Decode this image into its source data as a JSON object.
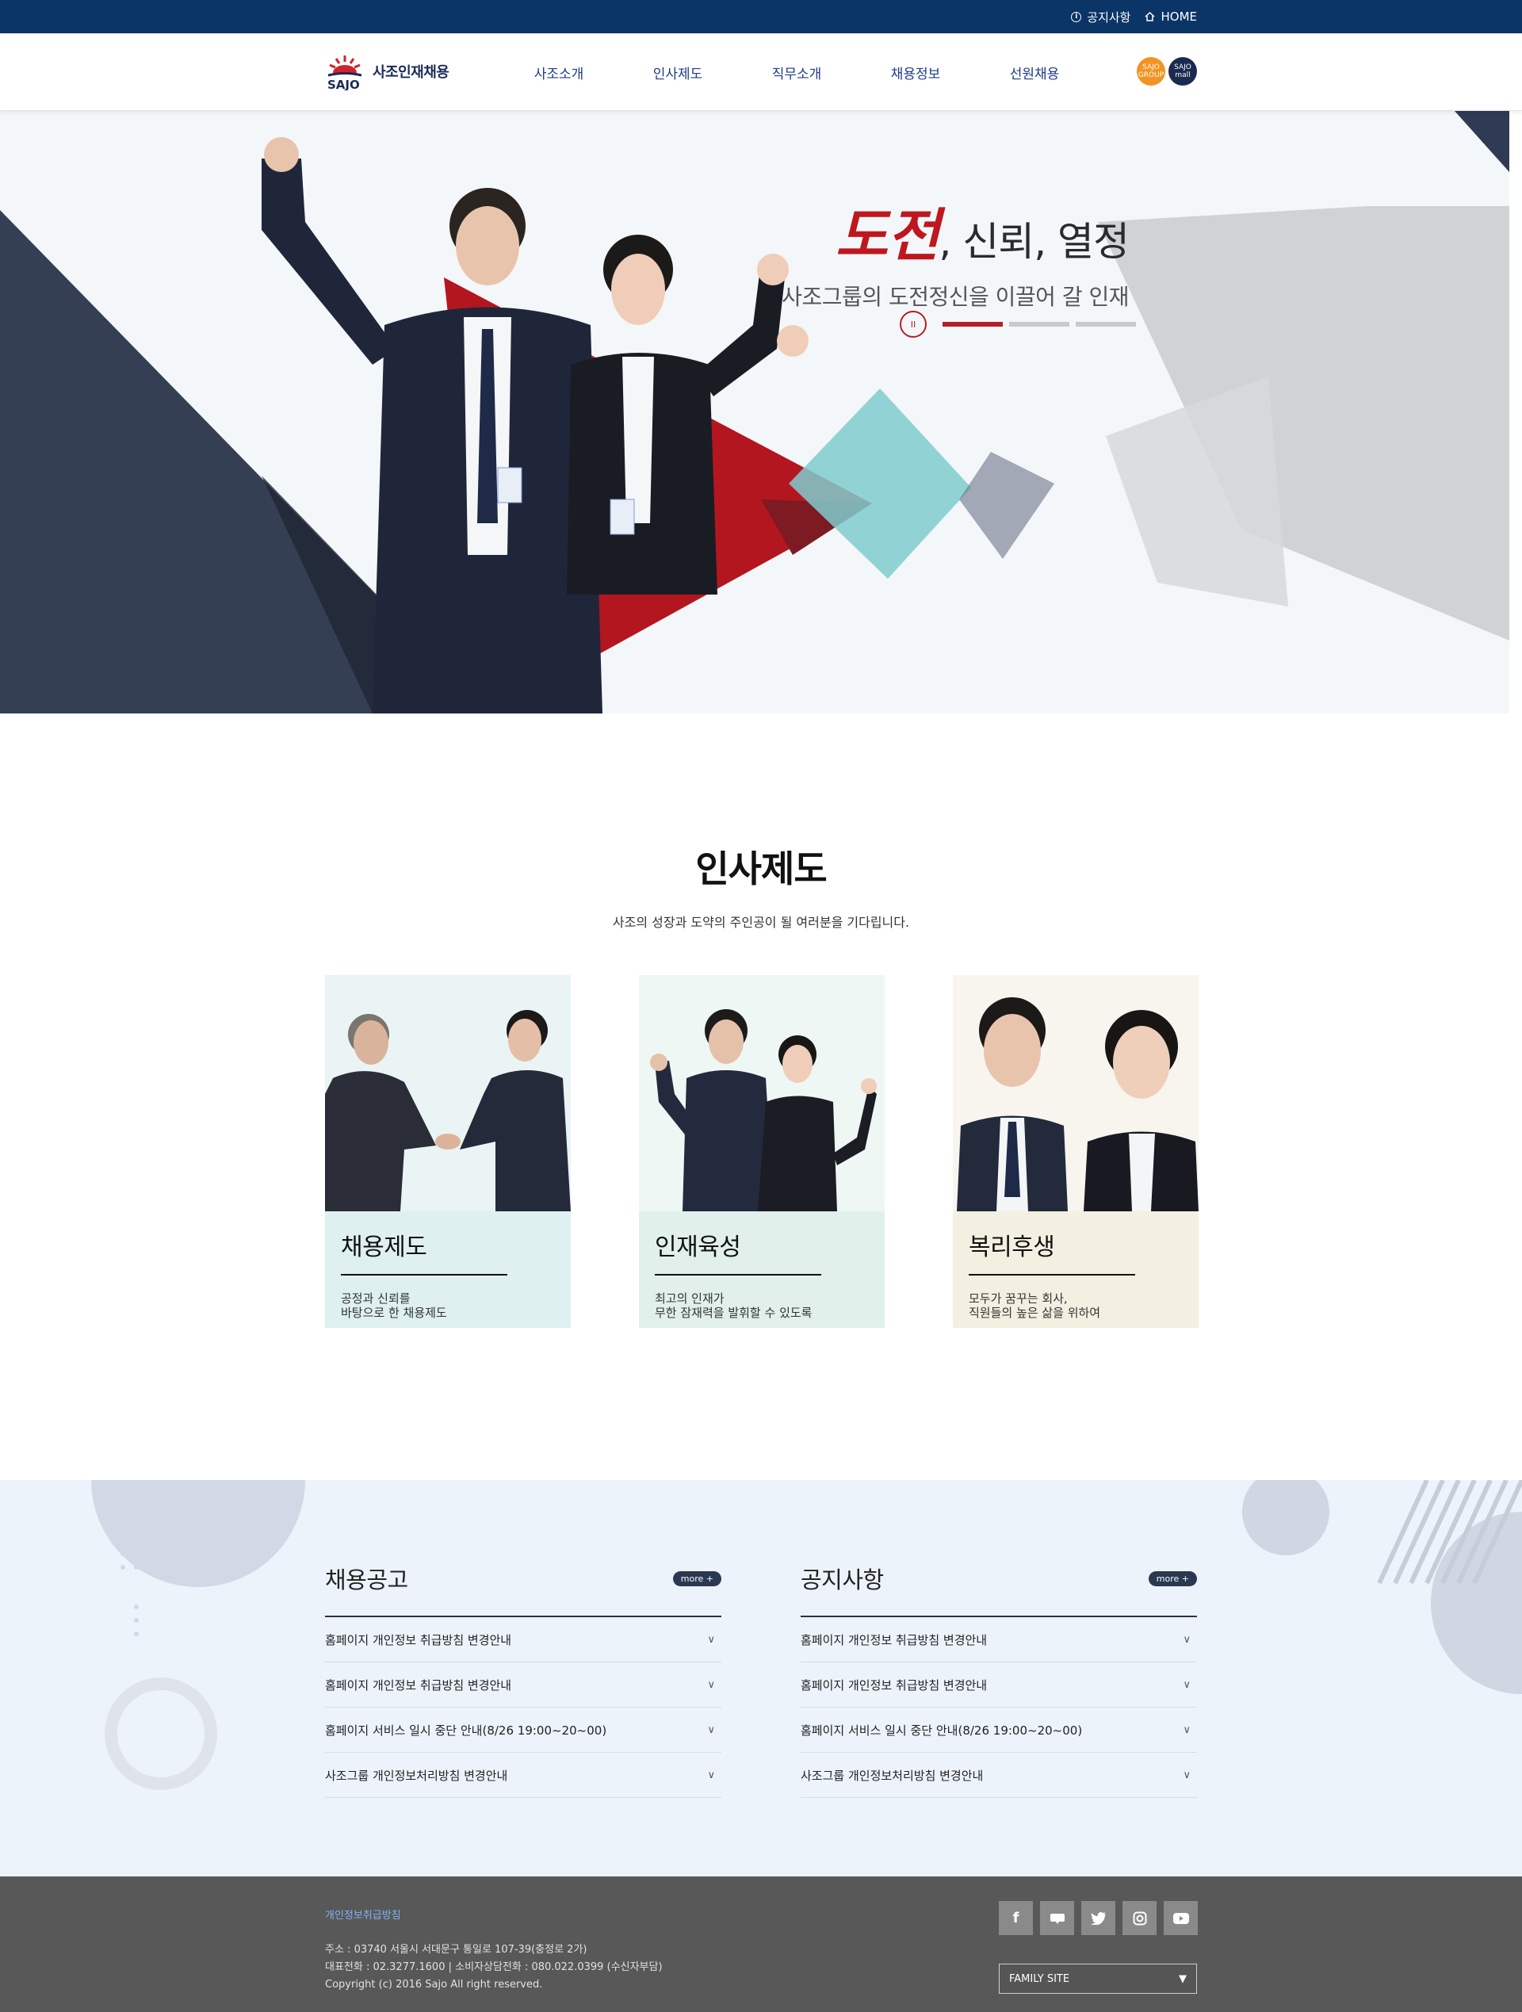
{
  "topbar": {
    "notice_label": "공지사항",
    "home_label": "HOME"
  },
  "header": {
    "logo_text": "사조인재채용",
    "logo_sub": "SAJO",
    "nav": [
      "사조소개",
      "인사제도",
      "직무소개",
      "채용정보",
      "선원채용"
    ],
    "site_group": "SAJO GROUP",
    "site_mall": "SAJO mall"
  },
  "hero": {
    "headline_red": "도전",
    "headline_rest": ", 신뢰, 열정",
    "subline": "사조그룹의 도전정신을 이끌어 갈 인재",
    "pause_symbol": "II",
    "slides_total": 3,
    "slide_active": 1,
    "colors": {
      "accent_red": "#c0171e",
      "navy": "#343f53",
      "teal": "#7fcdce"
    }
  },
  "hr": {
    "title": "인사제도",
    "desc": "사조의 성장과 도약의 주인공이 될 여러분을 기다립니다.",
    "cards": [
      {
        "title": "채용제도",
        "line1": "공정과 신뢰를",
        "line2": "바탕으로 한 채용제도",
        "bg": "#dff0f1"
      },
      {
        "title": "인재육성",
        "line1": "최고의 인재가",
        "line2": "무한 잠재력을 발휘할 수 있도록",
        "bg": "#e1f0ea"
      },
      {
        "title": "복리후생",
        "line1": "모두가 꿈꾸는 회사,",
        "line2": "직원들의 높은 삶을 위하여",
        "bg": "#f3f0e1"
      }
    ]
  },
  "board": {
    "recruit": {
      "title": "채용공고",
      "more": "more +",
      "items": [
        "홈페이지 개인정보 취급방침 변경안내",
        "홈페이지 개인정보 취급방침 변경안내",
        "홈페이지 서비스 일시 중단 안내(8/26 19:00~20~00)",
        "사조그룹 개인정보처리방침 변경안내"
      ]
    },
    "notice": {
      "title": "공지사항",
      "more": "more +",
      "items": [
        "홈페이지 개인정보 취급방침 변경안내",
        "홈페이지 개인정보 취급방침 변경안내",
        "홈페이지 서비스 일시 중단 안내(8/26 19:00~20~00)",
        "사조그룹 개인정보처리방침 변경안내"
      ]
    },
    "chevron": "∨"
  },
  "footer": {
    "policy": "개인정보취급방침",
    "address": "주소 : 03740 서울시 서대문구 통일로 107-39(충정로 2가)",
    "phones": "대표전화 : 02.3277.1600 | 소비자상담전화 : 080.022.0399 (수신자부담)",
    "copyright": "Copyright (c) 2016 Sajo All right reserved.",
    "social_icons": [
      "facebook-icon",
      "blog-icon",
      "twitter-icon",
      "instagram-icon",
      "youtube-icon"
    ],
    "family_site": "FAMILY SITE",
    "family_arrow": "▼"
  }
}
